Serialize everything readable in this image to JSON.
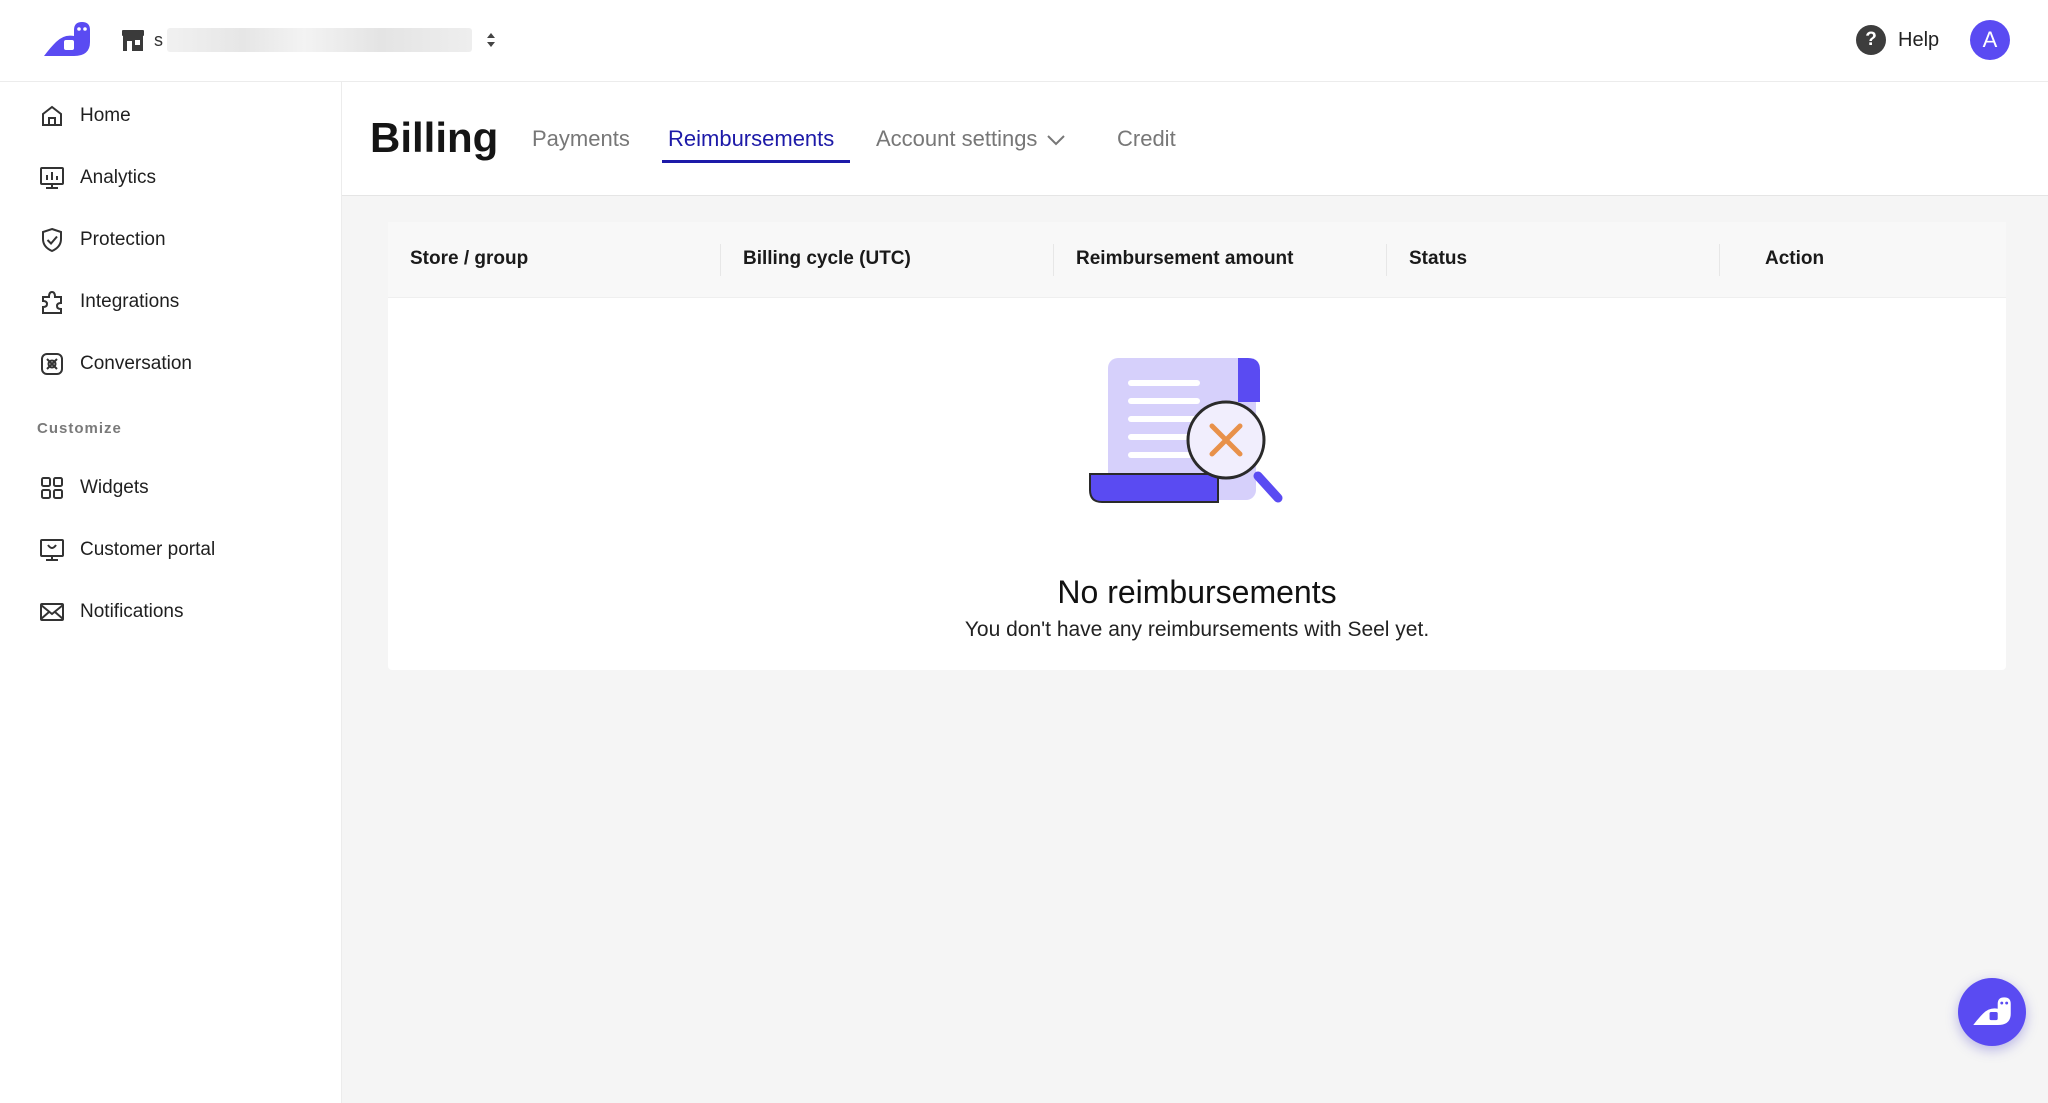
{
  "topbar": {
    "store_initial": "s",
    "help_label": "Help",
    "avatar_initial": "A"
  },
  "sidebar": {
    "items": [
      {
        "label": "Home",
        "icon": "home-icon"
      },
      {
        "label": "Analytics",
        "icon": "analytics-icon"
      },
      {
        "label": "Protection",
        "icon": "shield-check-icon"
      },
      {
        "label": "Integrations",
        "icon": "puzzle-icon"
      },
      {
        "label": "Conversation",
        "icon": "conversation-icon"
      }
    ],
    "section_label": "Customize",
    "customize_items": [
      {
        "label": "Widgets",
        "icon": "grid-icon"
      },
      {
        "label": "Customer portal",
        "icon": "monitor-icon"
      },
      {
        "label": "Notifications",
        "icon": "envelope-icon"
      }
    ]
  },
  "header": {
    "title": "Billing",
    "tabs": [
      {
        "label": "Payments",
        "active": false
      },
      {
        "label": "Reimbursements",
        "active": true
      },
      {
        "label": "Account settings",
        "active": false,
        "has_dropdown": true
      },
      {
        "label": "Credit",
        "active": false
      }
    ]
  },
  "table": {
    "columns": [
      "Store / group",
      "Billing cycle (UTC)",
      "Reimbursement amount",
      "Status",
      "Action"
    ],
    "rows": []
  },
  "empty_state": {
    "title": "No reimbursements",
    "subtitle": "You don't have any reimbursements with Seel yet."
  },
  "colors": {
    "brand": "#5a4bf2",
    "active_tab": "#1d1aa8",
    "illustration_light": "#d6d0fb",
    "illustration_accent": "#e8914a"
  }
}
